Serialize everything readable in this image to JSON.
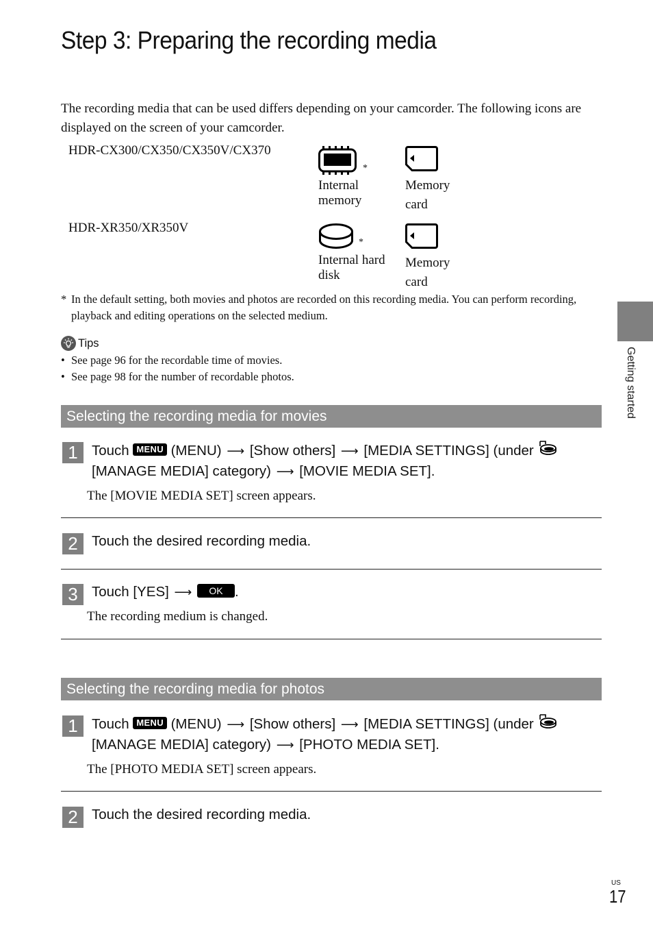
{
  "page": {
    "title": "Step 3: Preparing the recording media",
    "intro": "The recording media that can be used differs depending on your camcorder. The following icons are displayed on the screen of your camcorder.",
    "media_table": [
      {
        "model": "HDR-CX300/CX350/CX350V/CX370",
        "media": [
          {
            "icon": "internal-memory-icon",
            "label_lines": [
              "Internal",
              "memory"
            ],
            "asterisk": "*"
          },
          {
            "icon": "memory-card-icon",
            "label_lines": [
              "Memory",
              "card"
            ]
          }
        ]
      },
      {
        "model": "HDR-XR350/XR350V",
        "media": [
          {
            "icon": "internal-hard-disk-icon",
            "label_lines": [
              "Internal hard",
              "disk"
            ],
            "asterisk": "*"
          },
          {
            "icon": "memory-card-icon",
            "label_lines": [
              "Memory",
              "card"
            ]
          }
        ]
      }
    ],
    "footnote": {
      "mark": "*",
      "text": "In the default setting, both movies and photos are recorded on this recording media. You can perform recording, playback and editing operations on the selected medium."
    },
    "tips": {
      "heading": "Tips",
      "icon": "lightbulb-icon",
      "items": [
        "See page 96 for the recordable time of movies.",
        "See page 98 for the number of recordable photos."
      ]
    },
    "sections": [
      {
        "heading": "Selecting the recording media for movies",
        "steps": [
          {
            "number": "1",
            "parts": {
              "touch": "Touch",
              "menu_icon_label": "MENU",
              "menu_text": "(MENU)",
              "show_others": "[Show others]",
              "media_settings": "[MEDIA SETTINGS] (under",
              "manage_media": "[MANAGE MEDIA] category)",
              "target": "[MOVIE MEDIA SET]."
            },
            "sub": "The [MOVIE MEDIA SET] screen appears."
          },
          {
            "number": "2",
            "text": "Touch the desired recording media."
          },
          {
            "number": "3",
            "parts": {
              "touch": "Touch [YES]",
              "ok_label": "OK",
              "end": "."
            },
            "sub": "The recording medium is changed."
          }
        ]
      },
      {
        "heading": "Selecting the recording media for photos",
        "steps": [
          {
            "number": "1",
            "parts": {
              "touch": "Touch",
              "menu_icon_label": "MENU",
              "menu_text": "(MENU)",
              "show_others": "[Show others]",
              "media_settings": "[MEDIA SETTINGS] (under",
              "manage_media": "[MANAGE MEDIA] category)",
              "target": "[PHOTO MEDIA SET]."
            },
            "sub": "The [PHOTO MEDIA SET] screen appears."
          },
          {
            "number": "2",
            "text": "Touch the desired recording media."
          }
        ]
      }
    ],
    "arrow": "⟶",
    "side_tab": {
      "label": "Getting started",
      "color": "#808080"
    },
    "footer": {
      "region": "US",
      "page_number": "17"
    }
  },
  "colors": {
    "section_bar": "#8e8e8e",
    "step_number_box": "#808080",
    "text": "#111111"
  }
}
